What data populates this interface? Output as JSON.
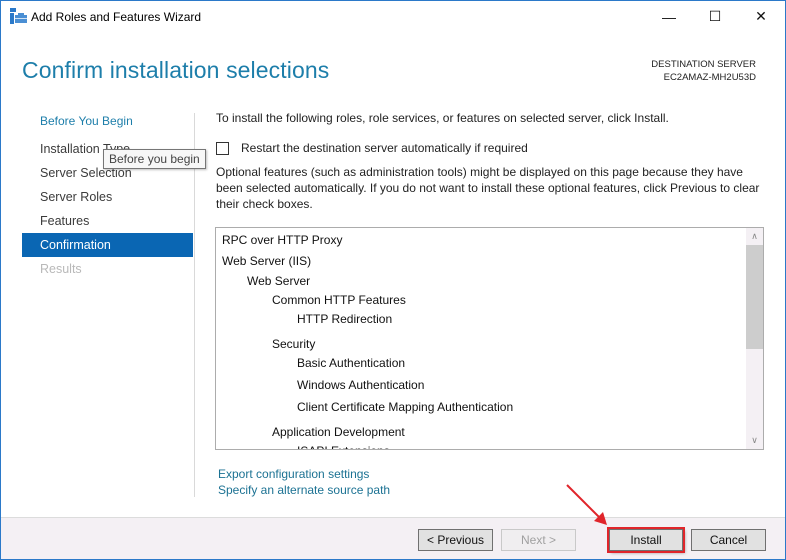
{
  "window": {
    "title": "Add Roles and Features Wizard",
    "controls": {
      "minimize": "—",
      "maximize": "☐",
      "close": "✕"
    }
  },
  "header": {
    "page_title": "Confirm installation selections",
    "destination_label": "DESTINATION SERVER",
    "destination_server": "EC2AMAZ-MH2U53D"
  },
  "nav": {
    "items": [
      {
        "label": "Before You Begin",
        "state": "link"
      },
      {
        "label": "Installation Type",
        "state": "normal"
      },
      {
        "label": "Server Selection",
        "state": "normal"
      },
      {
        "label": "Server Roles",
        "state": "normal"
      },
      {
        "label": "Features",
        "state": "normal"
      },
      {
        "label": "Confirmation",
        "state": "active"
      },
      {
        "label": "Results",
        "state": "disabled"
      }
    ],
    "tooltip": "Before you begin"
  },
  "content": {
    "intro": "To install the following roles, role services, or features on selected server, click Install.",
    "restart_checkbox": {
      "label": "Restart the destination server automatically if required",
      "checked": false
    },
    "optional_text": "Optional features (such as administration tools) might be displayed on this page because they have been selected automatically. If you do not want to install these optional features, click Previous to clear their check boxes.",
    "selections": [
      {
        "label": "RPC over HTTP Proxy",
        "level": 0
      },
      {
        "label": "Web Server (IIS)",
        "level": 0
      },
      {
        "label": "Web Server",
        "level": 1
      },
      {
        "label": "Common HTTP Features",
        "level": 2
      },
      {
        "label": "HTTP Redirection",
        "level": 3
      },
      {
        "label": "Security",
        "level": 2
      },
      {
        "label": "Basic Authentication",
        "level": 3
      },
      {
        "label": "Windows Authentication",
        "level": 3
      },
      {
        "label": "Client Certificate Mapping Authentication",
        "level": 3
      },
      {
        "label": "Application Development",
        "level": 2
      },
      {
        "label": "ISAPI Extensions",
        "level": 3
      }
    ],
    "links": {
      "export": "Export configuration settings",
      "alternate_source": "Specify an alternate source path"
    }
  },
  "footer": {
    "previous": "< Previous",
    "next": "Next >",
    "install": "Install",
    "cancel": "Cancel"
  },
  "colors": {
    "accent": "#0a66b3",
    "title": "#1d7eaa",
    "link": "#1c7293",
    "highlight": "#e0252b"
  }
}
